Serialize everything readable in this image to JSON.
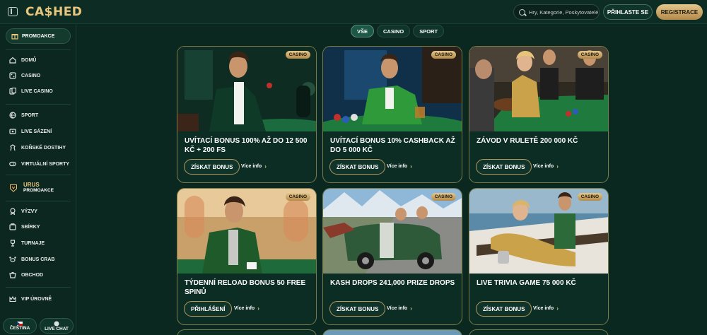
{
  "header": {
    "logo": "CA$HED",
    "search_placeholder": "Hry, Kategorie, Poskytovatelé",
    "login_label": "PŘIHLASTE SE",
    "register_label": "REGISTRACE"
  },
  "sidebar": {
    "promo_label": "PROMOAKCE",
    "items": [
      {
        "label": "DOMŮ",
        "icon": "home-icon"
      },
      {
        "label": "CASINO",
        "icon": "casino-icon"
      },
      {
        "label": "LIVE CASINO",
        "icon": "live-casino-icon"
      },
      {
        "label": "SPORT",
        "icon": "sport-icon"
      },
      {
        "label": "LIVE SÁZENÍ",
        "icon": "live-betting-icon"
      },
      {
        "label": "KOŇSKÉ DOSTIHY",
        "icon": "horse-icon"
      },
      {
        "label": "VIRTUÁLNÍ SPORTY",
        "icon": "virtual-sports-icon"
      }
    ],
    "urus": {
      "line1": "URUS",
      "line2": "PROMOAKCE"
    },
    "items2": [
      {
        "label": "VÝZVY",
        "icon": "challenges-icon"
      },
      {
        "label": "SBÍRKY",
        "icon": "collections-icon"
      },
      {
        "label": "TURNAJE",
        "icon": "trophy-icon"
      },
      {
        "label": "BONUS CRAB",
        "icon": "crab-icon"
      },
      {
        "label": "OBCHOD",
        "icon": "shop-icon"
      }
    ],
    "vip_label": "VIP ÚROVNĚ",
    "language_label": "ČEŠTINA",
    "live_chat_label": "LIVE CHAT"
  },
  "tabs": [
    {
      "label": "VŠE",
      "active": true
    },
    {
      "label": "CASINO",
      "active": false
    },
    {
      "label": "SPORT",
      "active": false
    }
  ],
  "cards": [
    {
      "badge": "CASINO",
      "title": "UVÍTACÍ BONUS 100% AŽ DO 12 500 KČ + 200 FS",
      "cta": "ZÍSKAT BONUS",
      "info": "Více info"
    },
    {
      "badge": "CASINO",
      "title": "UVÍTACÍ BONUS 10% CASHBACK AŽ DO 5 000 KČ",
      "cta": "ZÍSKAT BONUS",
      "info": "Více info"
    },
    {
      "badge": "CASINO",
      "title": "ZÁVOD V RULETĚ 200 000 KČ",
      "cta": "ZÍSKAT BONUS",
      "info": "Více info"
    },
    {
      "badge": "CASINO",
      "title": "TÝDENNÍ RELOAD BONUS 50 FREE SPINŮ",
      "cta": "PŘIHLÁŠENÍ",
      "info": "Více info"
    },
    {
      "badge": "CASINO",
      "title": "KASH DROPS 241,000 PRIZE DROPS",
      "cta": "ZÍSKAT BONUS",
      "info": "Více info"
    },
    {
      "badge": "CASINO",
      "title": "LIVE TRIVIA GAME 75 000 KČ",
      "cta": "ZÍSKAT BONUS",
      "info": "Více info"
    }
  ],
  "colors": {
    "accent_gold": "#e7c77d",
    "background": "#0b2820",
    "card_border": "#7b7a48"
  }
}
